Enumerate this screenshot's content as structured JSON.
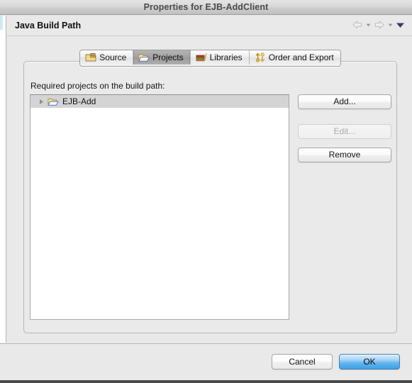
{
  "window": {
    "title": "Properties for EJB-AddClient"
  },
  "header": {
    "page_title": "Java Build Path",
    "nav": {
      "back_icon": "arrow-left-icon",
      "back_caret_icon": "caret-down-icon",
      "forward_icon": "arrow-right-icon",
      "forward_caret_icon": "caret-down-icon",
      "menu_icon": "triangle-down-icon"
    }
  },
  "tabs": [
    {
      "label": "Source",
      "icon": "source-folder-icon",
      "selected": false
    },
    {
      "label": "Projects",
      "icon": "open-folder-icon",
      "selected": true
    },
    {
      "label": "Libraries",
      "icon": "books-stack-icon",
      "selected": false
    },
    {
      "label": "Order and Export",
      "icon": "order-export-icon",
      "selected": false
    }
  ],
  "panel": {
    "field_label": "Required projects on the build path:",
    "tree": {
      "items": [
        {
          "label": "EJB-Add",
          "icon": "open-folder-icon",
          "twisty": "collapsed-triangle-icon",
          "selected": true,
          "expanded": false
        }
      ]
    },
    "side_buttons": [
      {
        "label": "Add...",
        "enabled": true
      },
      {
        "label": "Edit...",
        "enabled": false
      },
      {
        "label": "Remove",
        "enabled": true
      }
    ]
  },
  "footer": {
    "cancel_label": "Cancel",
    "ok_label": "OK"
  },
  "colors": {
    "window_background": "#e9e9e9",
    "title_bar_top": "#e4e4e4",
    "title_bar_bottom": "#bfbfbf",
    "selected_tab": "#a2a2a2",
    "tree_background": "#ffffff",
    "tree_selection": "#d4d4d4",
    "default_button_blue": "#62b4ee",
    "disabled_text": "#a9a9a9"
  }
}
